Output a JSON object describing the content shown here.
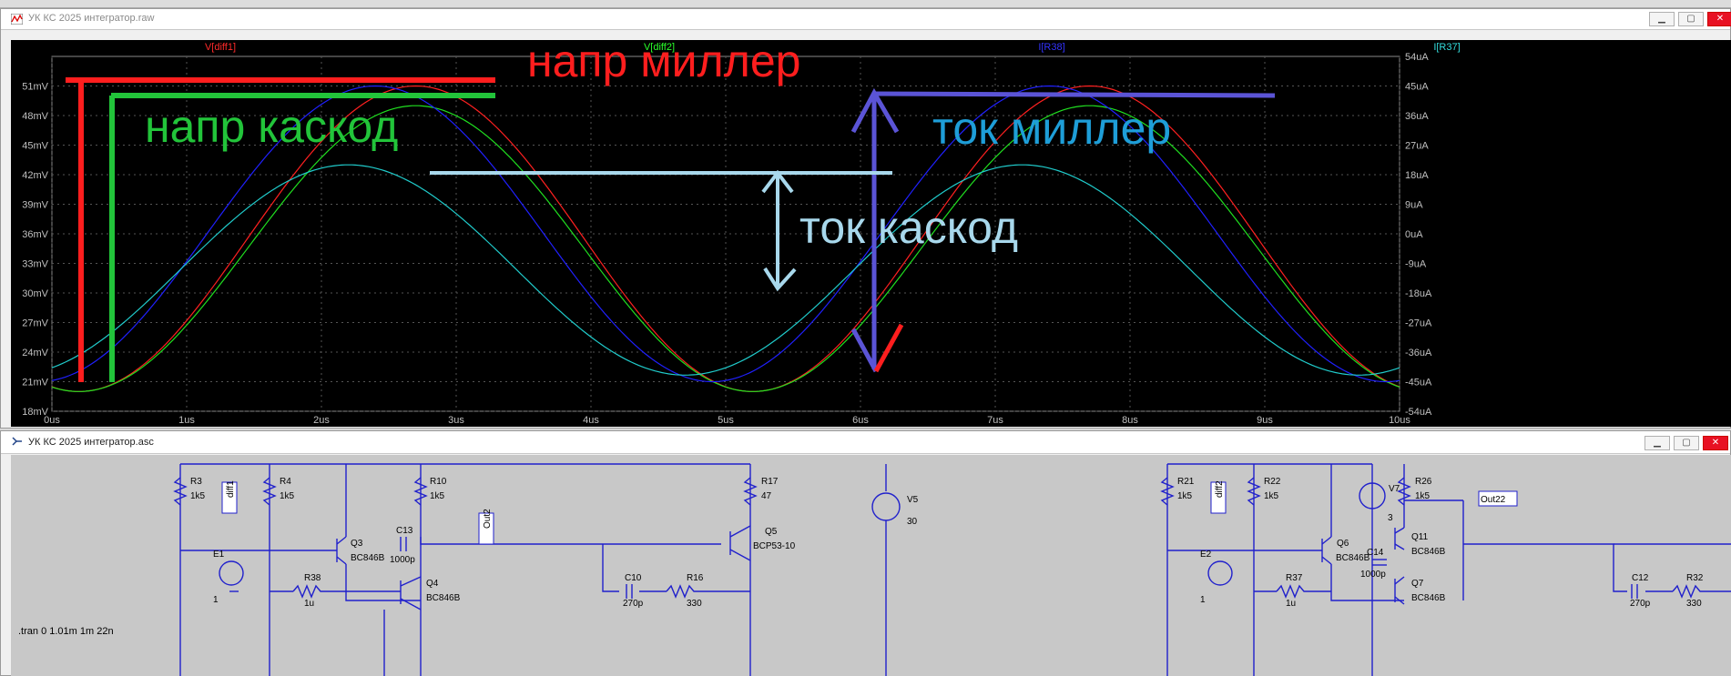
{
  "top_strip": {
    "text": "..."
  },
  "plot_window": {
    "title": "УК КС 2025 интегратор.raw",
    "trace_labels": [
      {
        "text": "V[diff1]",
        "color": "#ff2a2a"
      },
      {
        "text": "V[diff2]",
        "color": "#2aff2a"
      },
      {
        "text": "I[R38]",
        "color": "#3333ff"
      },
      {
        "text": "I[R37]",
        "color": "#33dddd"
      }
    ],
    "left_ticks": [
      "51mV",
      "48mV",
      "45mV",
      "42mV",
      "39mV",
      "36mV",
      "33mV",
      "30mV",
      "27mV",
      "24mV",
      "21mV",
      "18mV"
    ],
    "right_ticks": [
      "54uA",
      "45uA",
      "36uA",
      "27uA",
      "18uA",
      "9uA",
      "0uA",
      "-9uA",
      "-18uA",
      "-27uA",
      "-36uA",
      "-45uA",
      "-54uA"
    ],
    "x_ticks": [
      "0us",
      "1us",
      "2us",
      "3us",
      "4us",
      "5us",
      "6us",
      "7us",
      "8us",
      "9us",
      "10us"
    ],
    "annotations": {
      "napr_miller": "напр миллер",
      "napr_kaskod": "напр каскод",
      "tok_miller": "ток миллер",
      "tok_kaskod": "ток каскод"
    }
  },
  "chart_data": {
    "type": "line",
    "x": [
      0,
      1,
      2,
      3,
      4,
      5,
      6,
      7,
      8,
      9,
      10
    ],
    "x_unit": "us",
    "ylim_left_mV": [
      18,
      54
    ],
    "ylim_right_uA": [
      -54,
      54
    ],
    "grid": "on",
    "series": [
      {
        "name": "V[diff1]",
        "axis": "left",
        "color": "#ff2020",
        "amp": 15.5,
        "offset": 35.5,
        "peak_us": 2.7
      },
      {
        "name": "V[diff2]",
        "axis": "left",
        "color": "#20e020",
        "amp": 14.5,
        "offset": 34.5,
        "peak_us": 2.7
      },
      {
        "name": "I[R38]",
        "axis": "right",
        "color": "#2020ff",
        "amp": 45,
        "offset": 0,
        "peak_us": 2.4
      },
      {
        "name": "I[R37]",
        "axis": "right",
        "color": "#20cccc",
        "amp": 32,
        "offset": -11,
        "peak_us": 2.2
      }
    ]
  },
  "schematic_window": {
    "title": "УК КС 2025 интегратор.asc",
    "directive": ".tran 0 1.01m 1m 22n",
    "labels": {
      "R3": "R3",
      "R3v": "1k5",
      "R4": "R4",
      "R4v": "1k5",
      "diff1": "diff1",
      "E1": "E1",
      "E1v": "1",
      "R38": "R38",
      "R38v": "1u",
      "Q3": "Q3",
      "Q3m": "BC846B",
      "R10": "R10",
      "R10v": "1k5",
      "C13": "C13",
      "C13v": "1000p",
      "Q4": "Q4",
      "Q4m": "BC846B",
      "Out2": "Out2",
      "C10": "C10",
      "C10v": "270p",
      "R16": "R16",
      "R16v": "330",
      "R17": "R17",
      "R17v": "47",
      "Q5": "Q5",
      "Q5m": "BCP53-10",
      "V5": "V5",
      "V5v": "30",
      "R21": "R21",
      "R21v": "1k5",
      "R22": "R22",
      "R22v": "1k5",
      "diff2": "diff2",
      "E2": "E2",
      "E2v": "1",
      "R37": "R37",
      "R37v": "1u",
      "Q6": "Q6",
      "Q6m": "BC846B",
      "V7": "V7",
      "V7v": "3",
      "C14": "C14",
      "C14v": "1000p",
      "R26": "R26",
      "R26v": "1k5",
      "Q11": "Q11",
      "Q11m": "BC846B",
      "Q7": "Q7",
      "Q7m": "BC846B",
      "Out22": "Out22",
      "C12": "C12",
      "C12v": "270p",
      "R32": "R32",
      "R32v": "330"
    }
  }
}
